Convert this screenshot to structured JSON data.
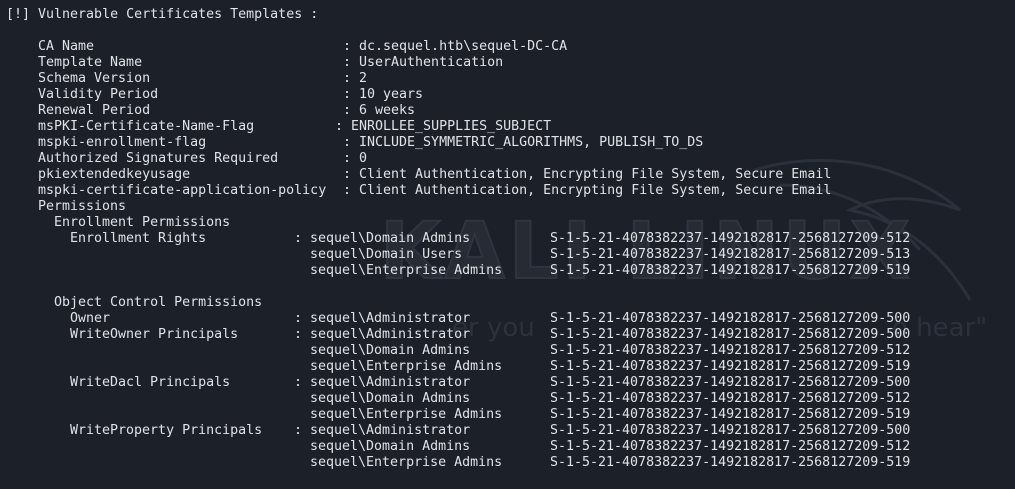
{
  "header": "[!] Vulnerable Certificates Templates :",
  "template_fields": [
    {
      "label": "CA Name",
      "value": ": dc.sequel.htb\\sequel-DC-CA"
    },
    {
      "label": "Template Name",
      "value": ": UserAuthentication"
    },
    {
      "label": "Schema Version",
      "value": ": 2"
    },
    {
      "label": "Validity Period",
      "value": ": 10 years"
    },
    {
      "label": "Renewal Period",
      "value": ": 6 weeks"
    },
    {
      "label": "msPKI-Certificate-Name-Flag",
      "value": ": ENROLLEE_SUPPLIES_SUBJECT"
    },
    {
      "label": "mspki-enrollment-flag",
      "value": ": INCLUDE_SYMMETRIC_ALGORITHMS, PUBLISH_TO_DS"
    },
    {
      "label": "Authorized Signatures Required",
      "value": ": 0"
    },
    {
      "label": "pkiextendedkeyusage",
      "value": ": Client Authentication, Encrypting File System, Secure Email"
    },
    {
      "label": "mspki-certificate-application-policy",
      "value": ": Client Authentication, Encrypting File System, Secure Email"
    }
  ],
  "permissions_label": "Permissions",
  "enrollment_permissions_label": "Enrollment Permissions",
  "object_control_label": "Object Control Permissions",
  "permission_rows": [
    {
      "key": "Enrollment Rights",
      "sep": ":",
      "principal": "sequel\\Domain Admins",
      "sid": "S-1-5-21-4078382237-1492182817-2568127209-512"
    },
    {
      "key": "",
      "sep": "",
      "principal": "sequel\\Domain Users",
      "sid": "S-1-5-21-4078382237-1492182817-2568127209-513"
    },
    {
      "key": "",
      "sep": "",
      "principal": "sequel\\Enterprise Admins",
      "sid": "S-1-5-21-4078382237-1492182817-2568127209-519"
    }
  ],
  "object_rows": [
    {
      "key": "Owner",
      "sep": ":",
      "principal": "sequel\\Administrator",
      "sid": "S-1-5-21-4078382237-1492182817-2568127209-500"
    },
    {
      "key": "WriteOwner Principals",
      "sep": ":",
      "principal": "sequel\\Administrator",
      "sid": "S-1-5-21-4078382237-1492182817-2568127209-500"
    },
    {
      "key": "",
      "sep": "",
      "principal": "sequel\\Domain Admins",
      "sid": "S-1-5-21-4078382237-1492182817-2568127209-512"
    },
    {
      "key": "",
      "sep": "",
      "principal": "sequel\\Enterprise Admins",
      "sid": "S-1-5-21-4078382237-1492182817-2568127209-519"
    },
    {
      "key": "WriteDacl Principals",
      "sep": ":",
      "principal": "sequel\\Administrator",
      "sid": "S-1-5-21-4078382237-1492182817-2568127209-500"
    },
    {
      "key": "",
      "sep": "",
      "principal": "sequel\\Domain Admins",
      "sid": "S-1-5-21-4078382237-1492182817-2568127209-512"
    },
    {
      "key": "",
      "sep": "",
      "principal": "sequel\\Enterprise Admins",
      "sid": "S-1-5-21-4078382237-1492182817-2568127209-519"
    },
    {
      "key": "WriteProperty Principals",
      "sep": ":",
      "principal": "sequel\\Administrator",
      "sid": "S-1-5-21-4078382237-1492182817-2568127209-500"
    },
    {
      "key": "",
      "sep": "",
      "principal": "sequel\\Domain Admins",
      "sid": "S-1-5-21-4078382237-1492182817-2568127209-512"
    },
    {
      "key": "",
      "sep": "",
      "principal": "sequel\\Enterprise Admins",
      "sid": "S-1-5-21-4078382237-1492182817-2568127209-519"
    }
  ],
  "watermark": {
    "brand": "KALI LINUX",
    "tagline_left": "er you",
    "tagline_right": "o hear\""
  },
  "colors": {
    "background": "#1c2028",
    "text": "#dfe2e7",
    "watermark": "#2a303a"
  }
}
